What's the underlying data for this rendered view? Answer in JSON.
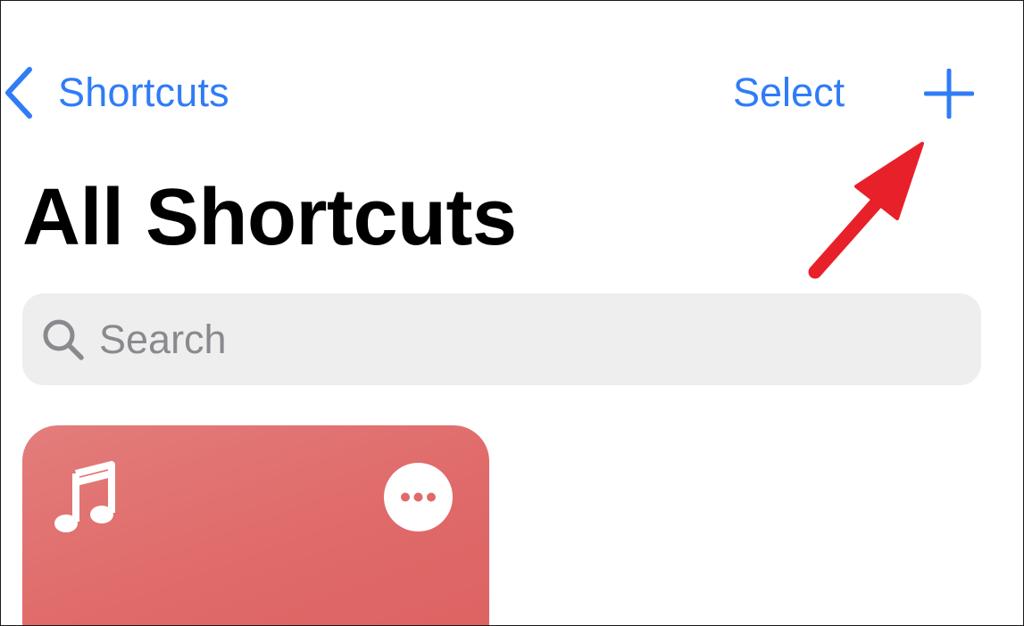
{
  "nav": {
    "back_label": "Shortcuts",
    "select_label": "Select",
    "back_icon": "chevron-left-icon",
    "add_icon": "plus-icon"
  },
  "page": {
    "title": "All Shortcuts"
  },
  "search": {
    "placeholder": "Search",
    "value": "",
    "icon": "magnifying-glass-icon"
  },
  "shortcuts": [
    {
      "icon": "music-note-icon",
      "more_icon": "ellipsis-icon",
      "color": "#e06a69"
    }
  ],
  "annotation": {
    "icon": "red-arrow",
    "color": "#e8202a"
  },
  "colors": {
    "accent": "#2f7cf6",
    "search_bg": "#eeeeef",
    "placeholder": "#8a8a8e"
  }
}
